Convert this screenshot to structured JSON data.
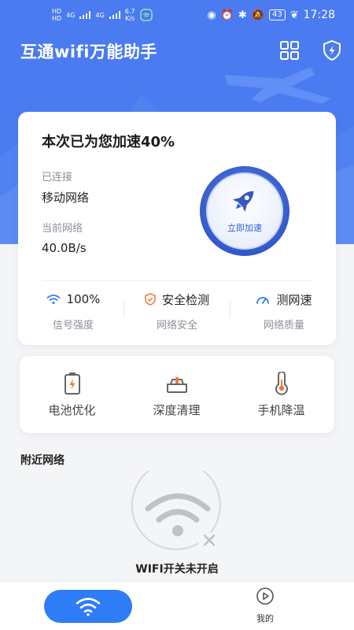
{
  "status_bar": {
    "sim1": "HD",
    "sim2": "HD",
    "net1": "4G",
    "net2": "4G",
    "speed_value": "6.7",
    "speed_unit": "K/s",
    "battery": "43",
    "time": "17:28"
  },
  "header": {
    "title": "互通wifi万能助手",
    "grid_icon": "grid-icon",
    "shield_icon": "shield-bolt-icon"
  },
  "main_card": {
    "headline": "本次已为您加速40%",
    "connection_label": "已连接",
    "connection_value": "移动网络",
    "current_network_label": "当前网络",
    "current_network_value": "40.0B/s",
    "boost_button_label": "立即加速",
    "stats": [
      {
        "icon": "wifi-icon",
        "value": "100%",
        "label": "信号强度"
      },
      {
        "icon": "shield-check-icon",
        "value": "安全检测",
        "label": "网络安全"
      },
      {
        "icon": "speedometer-icon",
        "value": "测网速",
        "label": "网络质量"
      }
    ]
  },
  "tools": [
    {
      "icon": "battery-icon",
      "label": "电池优化"
    },
    {
      "icon": "cleaner-icon",
      "label": "深度清理"
    },
    {
      "icon": "thermometer-icon",
      "label": "手机降温"
    }
  ],
  "nearby": {
    "title": "附近网络",
    "wifi_off_text": "WIFI开关未开启"
  },
  "tabbar": {
    "wifi_tab_icon": "wifi-icon",
    "mine_label": "我的"
  },
  "colors": {
    "brand_blue": "#4a7bf0",
    "accent_blue": "#2f7df6",
    "button_blue": "#3a63d8",
    "warning_orange": "#f07a3a"
  }
}
